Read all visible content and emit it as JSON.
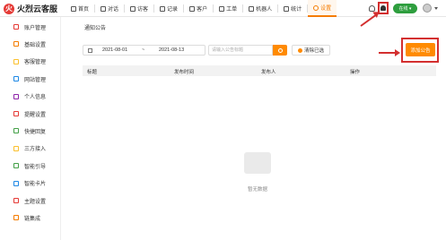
{
  "app": {
    "name": "火烈云客服",
    "logo_mark": "火"
  },
  "nav": {
    "items": [
      {
        "label": "首页",
        "icon": "home-icon"
      },
      {
        "label": "对话",
        "icon": "chat-icon"
      },
      {
        "label": "访客",
        "icon": "visitor-icon"
      },
      {
        "label": "记录",
        "icon": "record-icon"
      },
      {
        "label": "客户",
        "icon": "customer-icon"
      },
      {
        "label": "工单",
        "icon": "ticket-icon"
      },
      {
        "label": "机器人",
        "icon": "robot-icon"
      },
      {
        "label": "统计",
        "icon": "stats-icon"
      },
      {
        "label": "设置",
        "icon": "settings-icon",
        "active": true
      }
    ]
  },
  "topright": {
    "status": "在线 ▾",
    "has_notification_highlight": true
  },
  "sidebar": {
    "items": [
      {
        "label": "账户管理",
        "icon_color": "#e53935"
      },
      {
        "label": "基础设置",
        "icon_color": "#f57c00"
      },
      {
        "label": "客服管理",
        "icon_color": "#fbc02d"
      },
      {
        "label": "网站管理",
        "icon_color": "#1e88e5"
      },
      {
        "label": "个人信息",
        "icon_color": "#8e24aa"
      },
      {
        "label": "提醒设置",
        "icon_color": "#e53935"
      },
      {
        "label": "快捷回复",
        "icon_color": "#43a047"
      },
      {
        "label": "三方接入",
        "icon_color": "#fbc02d"
      },
      {
        "label": "智能引导",
        "icon_color": "#43a047"
      },
      {
        "label": "智能卡片",
        "icon_color": "#1e88e5"
      },
      {
        "label": "主题设置",
        "icon_color": "#e53935"
      },
      {
        "label": "链集成",
        "icon_color": "#f57c00"
      }
    ]
  },
  "main": {
    "breadcrumb": "通知公告",
    "filters": {
      "date_start": "2021-08-01",
      "date_sep": "~",
      "date_end": "2021-08-13",
      "keyword_placeholder": "请输入公告标题",
      "clear_label": "清除已选"
    },
    "add_button": "添加公告",
    "table": {
      "columns": [
        "标题",
        "发布时间",
        "发布人",
        "操作"
      ]
    },
    "empty_text": "暂无数据"
  },
  "colors": {
    "accent": "#ff8a00",
    "annotation": "#d32f2f",
    "online": "#2e9e3e"
  }
}
